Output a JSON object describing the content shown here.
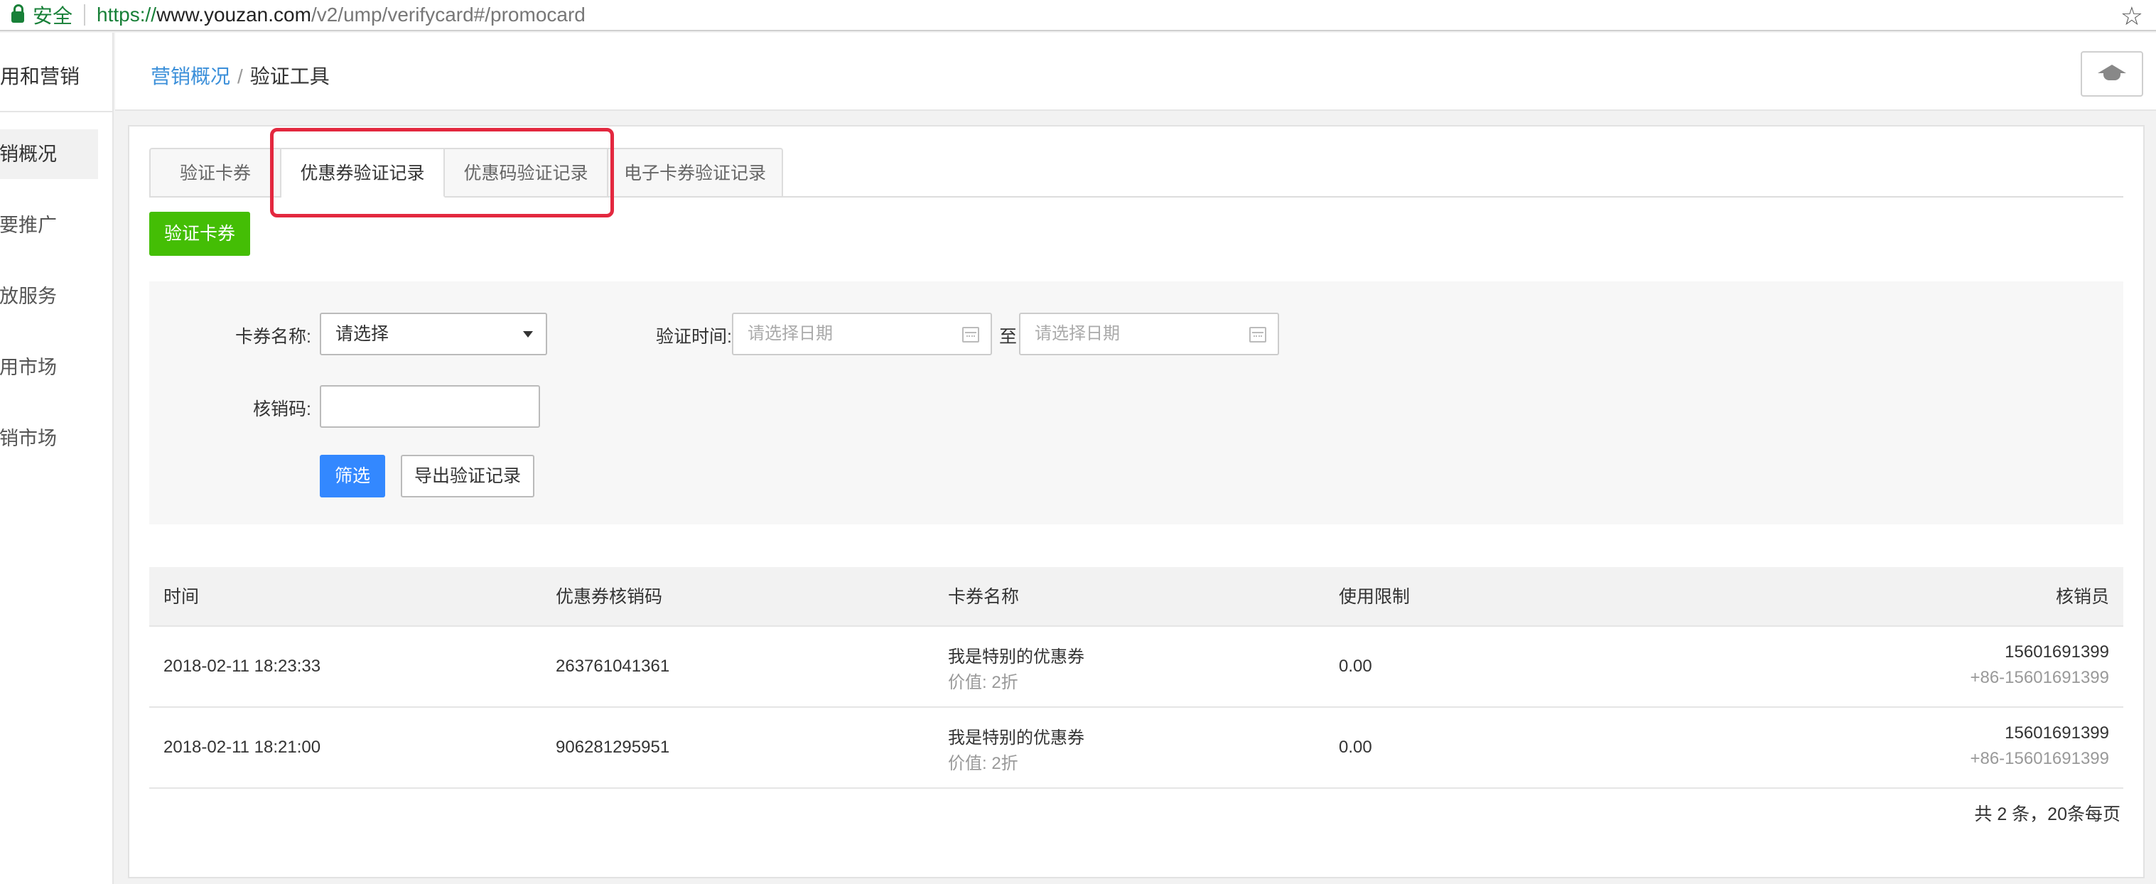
{
  "browser": {
    "secure_label": "安全",
    "url_scheme": "https://",
    "url_host": "www.youzan.com",
    "url_path": "/v2/ump/verifycard#/promocard",
    "star_icon": "☆"
  },
  "sidebar": {
    "title": "应用和营销",
    "items": [
      {
        "label": "营销概况",
        "active": true
      },
      {
        "label": "我要推广"
      },
      {
        "label": "开放服务"
      },
      {
        "label": "应用市场"
      },
      {
        "label": "分销市场"
      }
    ]
  },
  "header": {
    "breadcrumb_link": "营销概况",
    "breadcrumb_sep": "/",
    "breadcrumb_current": "验证工具",
    "help_icon": "graduation-cap-icon"
  },
  "tabs": [
    {
      "label": "验证卡券"
    },
    {
      "label": "优惠券验证记录",
      "active": true
    },
    {
      "label": "优惠码验证记录"
    },
    {
      "label": "电子卡券验证记录"
    }
  ],
  "verify_button": "验证卡券",
  "filter": {
    "card_name_label": "卡券名称:",
    "card_name_value": "请选择",
    "time_label": "验证时间:",
    "date_start_placeholder": "请选择日期",
    "date_to": "至",
    "date_end_placeholder": "请选择日期",
    "code_label": "核销码:",
    "code_value": "",
    "filter_button": "筛选",
    "export_button": "导出验证记录"
  },
  "table": {
    "headers": [
      "时间",
      "优惠券核销码",
      "卡券名称",
      "使用限制",
      "核销员"
    ],
    "rows": [
      {
        "time": "2018-02-11 18:23:33",
        "code": "263761041361",
        "name": "我是特别的优惠券",
        "value": "价值: 2折",
        "limit": "0.00",
        "staff": "15601691399",
        "staff_phone": "+86-15601691399"
      },
      {
        "time": "2018-02-11 18:21:00",
        "code": "906281295951",
        "name": "我是特别的优惠券",
        "value": "价值: 2折",
        "limit": "0.00",
        "staff": "15601691399",
        "staff_phone": "+86-15601691399"
      }
    ],
    "pagination": "共 2 条，20条每页"
  },
  "colors": {
    "accent_blue": "#3388ff",
    "accent_green": "#44be05",
    "highlight_red": "#e3283f",
    "link_blue": "#3b8fd9"
  }
}
